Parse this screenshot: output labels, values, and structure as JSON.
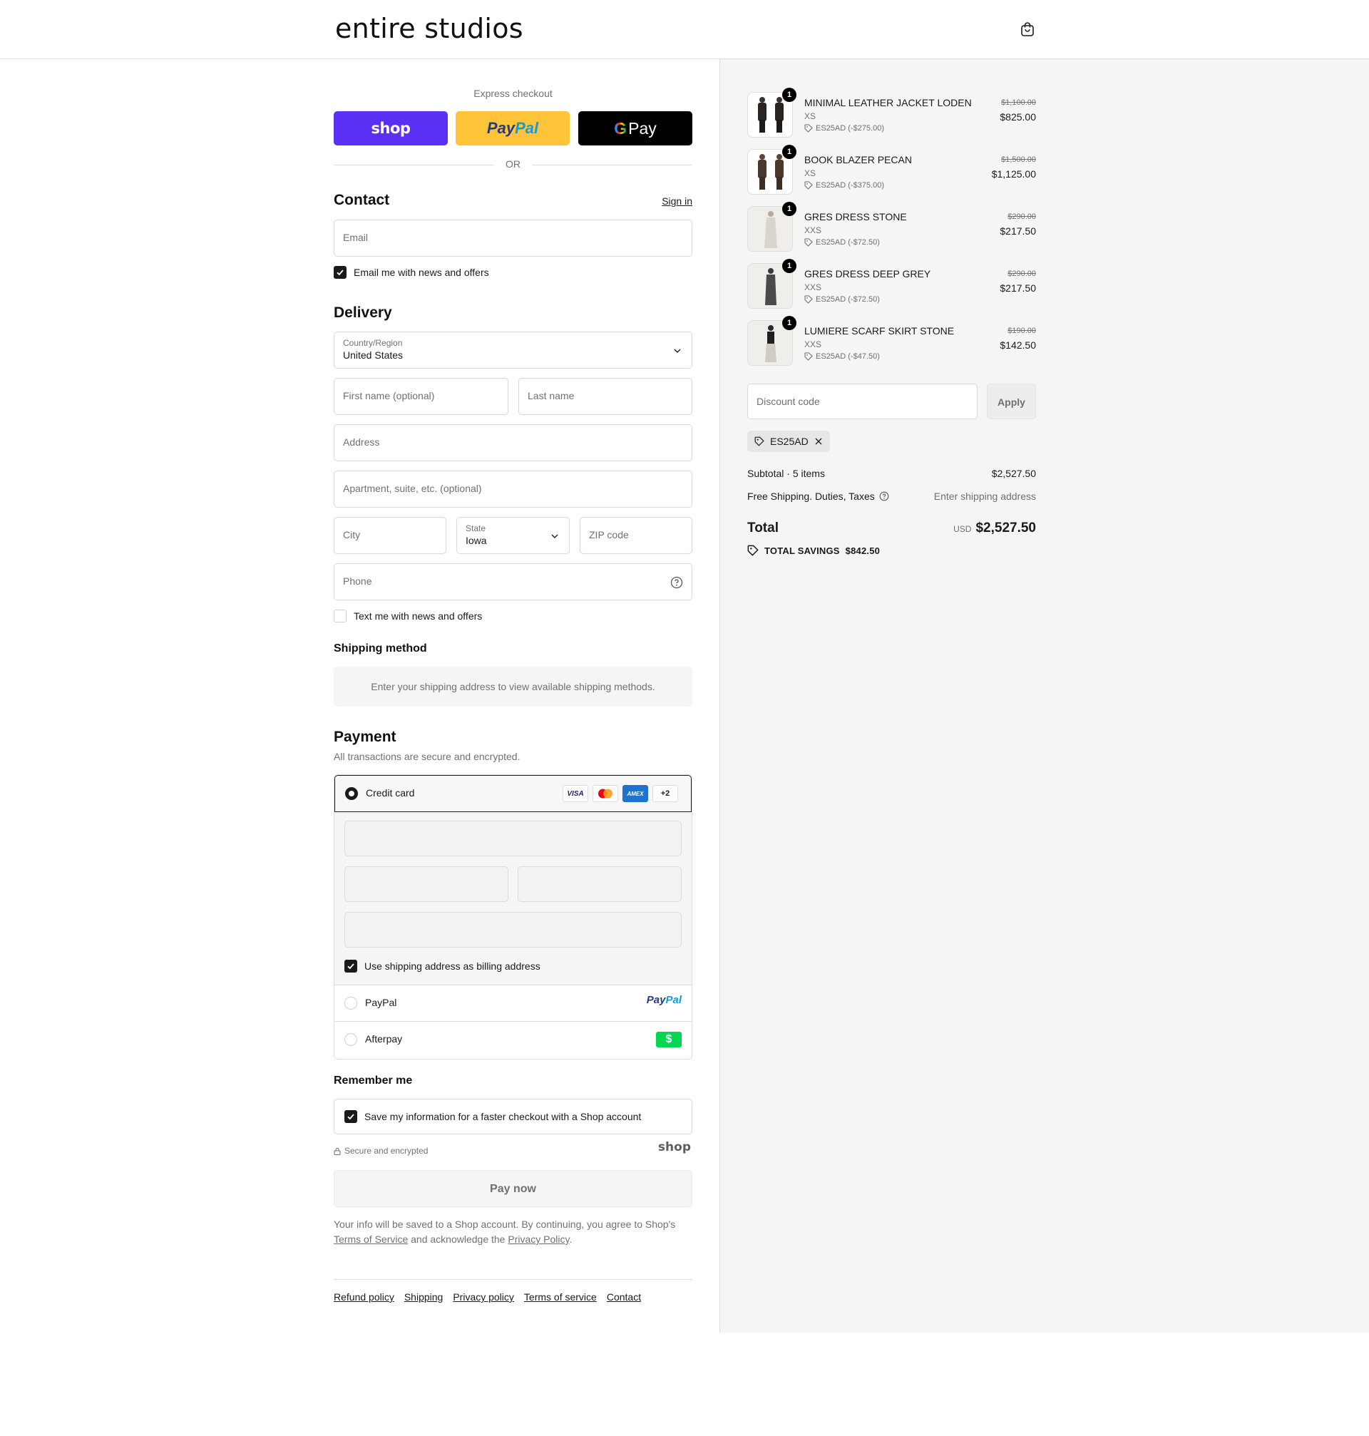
{
  "brand": {
    "logo": "entire studios"
  },
  "express": {
    "title": "Express checkout",
    "shop_label": "shop",
    "paypal_a": "Pay",
    "paypal_b": "Pal",
    "gpay_label": "Pay",
    "or": "OR"
  },
  "contact": {
    "heading": "Contact",
    "sign_in": "Sign in",
    "email_placeholder": "Email",
    "news_label": "Email me with news and offers"
  },
  "delivery": {
    "heading": "Delivery",
    "country_label": "Country/Region",
    "country_value": "United States",
    "first_name": "First name (optional)",
    "last_name": "Last name",
    "address": "Address",
    "apartment": "Apartment, suite, etc. (optional)",
    "city": "City",
    "state_label": "State",
    "state_value": "Iowa",
    "zip": "ZIP code",
    "phone": "Phone",
    "sms_label": "Text me with news and offers"
  },
  "shipping": {
    "heading": "Shipping method",
    "notice": "Enter your shipping address to view available shipping methods."
  },
  "payment": {
    "heading": "Payment",
    "subtitle": "All transactions are secure and encrypted.",
    "credit_card": "Credit card",
    "visa": "VISA",
    "amex": "AMEX",
    "more": "+2",
    "billing_label": "Use shipping address as billing address",
    "paypal": "PayPal",
    "paypal_logo_a": "Pay",
    "paypal_logo_b": "Pal",
    "afterpay": "Afterpay",
    "afterpay_logo": "$"
  },
  "remember": {
    "heading": "Remember me",
    "save_label": "Save my information for a faster checkout with a Shop account",
    "secure": "Secure and encrypted",
    "shop_logo": "shop"
  },
  "pay_now": "Pay now",
  "legal": {
    "text1": "Your info will be saved to a Shop account. By continuing, you agree to Shop's",
    "tos": "Terms of Service",
    "text2": "and acknowledge the",
    "privacy": "Privacy Policy",
    "end": "."
  },
  "footer": [
    "Refund policy",
    "Shipping",
    "Privacy policy",
    "Terms of service",
    "Contact"
  ],
  "cart": {
    "items": [
      {
        "qty": "1",
        "name": "MINIMAL LEATHER JACKET LODEN",
        "size": "XS",
        "discount": "ES25AD (-$275.00)",
        "original": "$1,100.00",
        "price": "$825.00"
      },
      {
        "qty": "1",
        "name": "BOOK BLAZER PECAN",
        "size": "XS",
        "discount": "ES25AD (-$375.00)",
        "original": "$1,500.00",
        "price": "$1,125.00"
      },
      {
        "qty": "1",
        "name": "GRES DRESS STONE",
        "size": "XXS",
        "discount": "ES25AD (-$72.50)",
        "original": "$290.00",
        "price": "$217.50"
      },
      {
        "qty": "1",
        "name": "GRES DRESS DEEP GREY",
        "size": "XXS",
        "discount": "ES25AD (-$72.50)",
        "original": "$290.00",
        "price": "$217.50"
      },
      {
        "qty": "1",
        "name": "LUMIERE SCARF SKIRT STONE",
        "size": "XXS",
        "discount": "ES25AD (-$47.50)",
        "original": "$190.00",
        "price": "$142.50"
      }
    ],
    "discount_placeholder": "Discount code",
    "apply": "Apply",
    "applied_code": "ES25AD",
    "subtotal_label": "Subtotal · 5 items",
    "subtotal_value": "$2,527.50",
    "shipping_label": "Free Shipping. Duties, Taxes",
    "shipping_value": "Enter shipping address",
    "total_label": "Total",
    "currency": "USD",
    "total_value": "$2,527.50",
    "savings_label": "TOTAL SAVINGS",
    "savings_value": "$842.50"
  }
}
